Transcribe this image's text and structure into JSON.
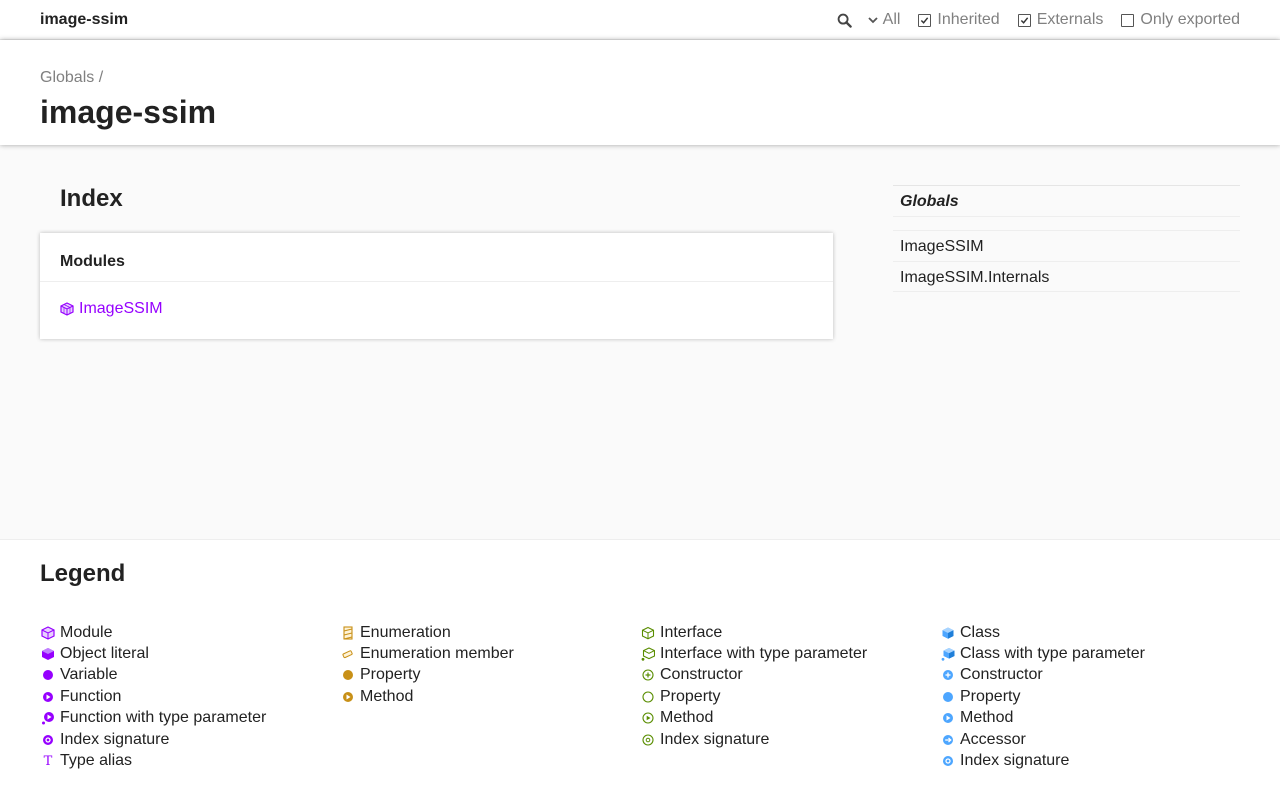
{
  "toolbar": {
    "project_title": "image-ssim",
    "filter_label": "All",
    "checkboxes": [
      {
        "label": "Inherited",
        "checked": true
      },
      {
        "label": "Externals",
        "checked": true
      },
      {
        "label": "Only exported",
        "checked": false
      }
    ]
  },
  "header": {
    "breadcrumb": "Globals /",
    "title": "image-ssim"
  },
  "index": {
    "heading": "Index",
    "section_title": "Modules",
    "modules": [
      "ImageSSIM"
    ]
  },
  "sidebar": {
    "globals": "Globals",
    "items": [
      "ImageSSIM",
      "ImageSSIM.Internals"
    ]
  },
  "legend": {
    "title": "Legend",
    "columns": [
      [
        "Module",
        "Object literal",
        "Variable",
        "Function",
        "Function with type parameter",
        "Index signature",
        "Type alias"
      ],
      [
        "Enumeration",
        "Enumeration member",
        "Property",
        "Method"
      ],
      [
        "Interface",
        "Interface with type parameter",
        "Constructor",
        "Property",
        "Method",
        "Index signature"
      ],
      [
        "Class",
        "Class with type parameter",
        "Constructor",
        "Property",
        "Method",
        "Accessor",
        "Index signature"
      ]
    ]
  },
  "colors": {
    "module": "#9600ff",
    "enum": "#c89017",
    "interface": "#598d00",
    "class": "#4da6ff",
    "muted": "#808080"
  }
}
